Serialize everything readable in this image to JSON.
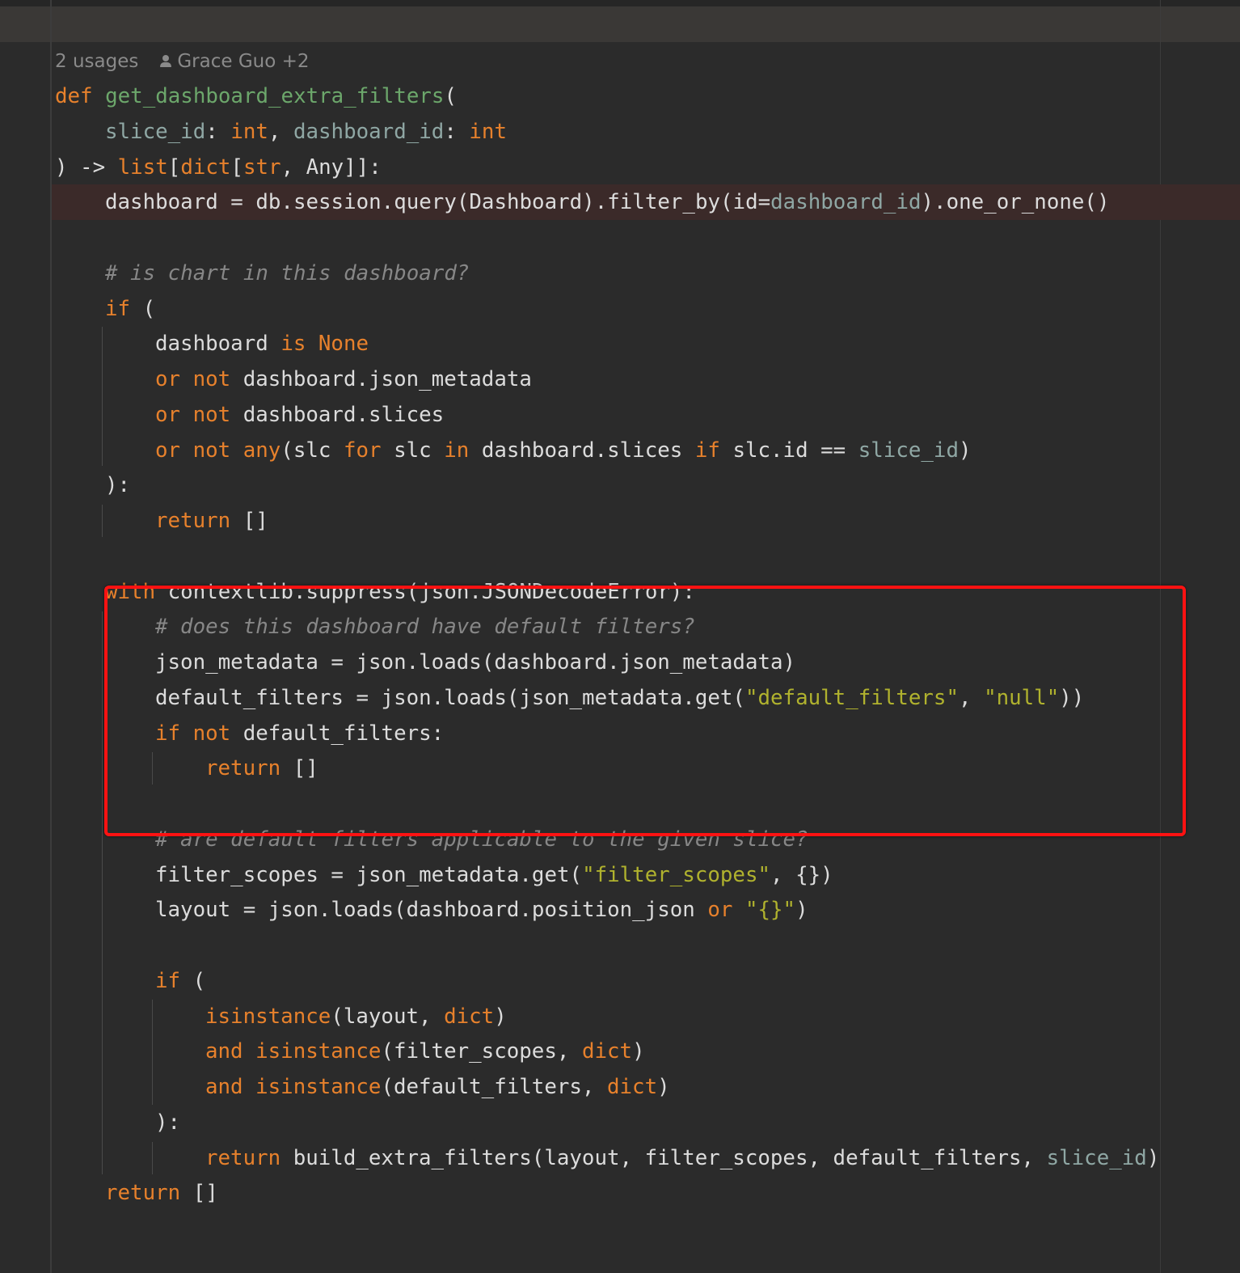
{
  "inlay": {
    "usages": "2 usages",
    "author": "Grace Guo +2"
  },
  "code": [
    {
      "indent": 0,
      "tokens": [
        [
          "k",
          "def "
        ],
        [
          "fn",
          "get_dashboard_extra_filters"
        ],
        [
          "t",
          "("
        ]
      ]
    },
    {
      "indent": 1,
      "tokens": [
        [
          "p",
          "slice_id"
        ],
        [
          "t",
          ": "
        ],
        [
          "k",
          "int"
        ],
        [
          "t",
          ", "
        ],
        [
          "p",
          "dashboard_id"
        ],
        [
          "t",
          ": "
        ],
        [
          "k",
          "int"
        ]
      ]
    },
    {
      "indent": 0,
      "tokens": [
        [
          "t",
          ") -> "
        ],
        [
          "k",
          "list"
        ],
        [
          "t",
          "["
        ],
        [
          "k",
          "dict"
        ],
        [
          "t",
          "["
        ],
        [
          "k",
          "str"
        ],
        [
          "t",
          ", Any]]:"
        ]
      ]
    },
    {
      "indent": 1,
      "error": true,
      "tokens": [
        [
          "t",
          "dashboard = db.session.query(Dashboard).filter_by(id="
        ],
        [
          "p",
          "dashboard_id"
        ],
        [
          "t",
          ").one_or_none()"
        ]
      ]
    },
    {
      "indent": 0,
      "tokens": []
    },
    {
      "indent": 1,
      "tokens": [
        [
          "c",
          "# is chart in this dashboard?"
        ]
      ]
    },
    {
      "indent": 1,
      "tokens": [
        [
          "k",
          "if "
        ],
        [
          "t",
          "("
        ]
      ]
    },
    {
      "indent": 2,
      "tokens": [
        [
          "t",
          "dashboard "
        ],
        [
          "k",
          "is None"
        ]
      ]
    },
    {
      "indent": 2,
      "tokens": [
        [
          "k",
          "or not "
        ],
        [
          "t",
          "dashboard.json_metadata"
        ]
      ]
    },
    {
      "indent": 2,
      "tokens": [
        [
          "k",
          "or not "
        ],
        [
          "t",
          "dashboard.slices"
        ]
      ]
    },
    {
      "indent": 2,
      "tokens": [
        [
          "k",
          "or not any"
        ],
        [
          "t",
          "(slc "
        ],
        [
          "k",
          "for "
        ],
        [
          "t",
          "slc "
        ],
        [
          "k",
          "in "
        ],
        [
          "t",
          "dashboard.slices "
        ],
        [
          "k",
          "if "
        ],
        [
          "t",
          "slc.id == "
        ],
        [
          "p",
          "slice_id"
        ],
        [
          "t",
          ")"
        ]
      ]
    },
    {
      "indent": 1,
      "tokens": [
        [
          "t",
          "):"
        ]
      ]
    },
    {
      "indent": 2,
      "tokens": [
        [
          "k",
          "return "
        ],
        [
          "t",
          "[]"
        ]
      ]
    },
    {
      "indent": 0,
      "tokens": []
    },
    {
      "indent": 1,
      "tokens": [
        [
          "k",
          "with "
        ],
        [
          "t",
          "contextlib.suppress(json.JSONDecodeError):"
        ]
      ]
    },
    {
      "indent": 2,
      "tokens": [
        [
          "c",
          "# does this dashboard have default filters?"
        ]
      ]
    },
    {
      "indent": 2,
      "tokens": [
        [
          "t",
          "json_metadata = json.loads(dashboard.json_metadata)"
        ]
      ]
    },
    {
      "indent": 2,
      "tokens": [
        [
          "t",
          "default_filters = json.loads(json_metadata.get("
        ],
        [
          "s",
          "\"default_filters\""
        ],
        [
          "t",
          ", "
        ],
        [
          "s",
          "\"null\""
        ],
        [
          "t",
          "))"
        ]
      ]
    },
    {
      "indent": 2,
      "tokens": [
        [
          "k",
          "if not "
        ],
        [
          "t",
          "default_filters:"
        ]
      ]
    },
    {
      "indent": 3,
      "tokens": [
        [
          "k",
          "return "
        ],
        [
          "t",
          "[]"
        ]
      ]
    },
    {
      "indent": 0,
      "tokens": []
    },
    {
      "indent": 2,
      "tokens": [
        [
          "c",
          "# are default filters applicable to the given slice?"
        ]
      ]
    },
    {
      "indent": 2,
      "tokens": [
        [
          "t",
          "filter_scopes = json_metadata.get("
        ],
        [
          "s",
          "\"filter_scopes\""
        ],
        [
          "t",
          ", {})"
        ]
      ]
    },
    {
      "indent": 2,
      "tokens": [
        [
          "t",
          "layout = json.loads(dashboard.position_json "
        ],
        [
          "k",
          "or "
        ],
        [
          "s",
          "\"{}\""
        ],
        [
          "t",
          ")"
        ]
      ]
    },
    {
      "indent": 0,
      "tokens": []
    },
    {
      "indent": 2,
      "tokens": [
        [
          "k",
          "if "
        ],
        [
          "t",
          "("
        ]
      ]
    },
    {
      "indent": 3,
      "tokens": [
        [
          "k",
          "isinstance"
        ],
        [
          "t",
          "(layout, "
        ],
        [
          "k",
          "dict"
        ],
        [
          "t",
          ")"
        ]
      ]
    },
    {
      "indent": 3,
      "tokens": [
        [
          "k",
          "and isinstance"
        ],
        [
          "t",
          "(filter_scopes, "
        ],
        [
          "k",
          "dict"
        ],
        [
          "t",
          ")"
        ]
      ]
    },
    {
      "indent": 3,
      "tokens": [
        [
          "k",
          "and isinstance"
        ],
        [
          "t",
          "(default_filters, "
        ],
        [
          "k",
          "dict"
        ],
        [
          "t",
          ")"
        ]
      ]
    },
    {
      "indent": 2,
      "tokens": [
        [
          "t",
          "):"
        ]
      ]
    },
    {
      "indent": 3,
      "tokens": [
        [
          "k",
          "return "
        ],
        [
          "t",
          "build_extra_filters(layout, filter_scopes, default_filters, "
        ],
        [
          "p",
          "slice_id"
        ],
        [
          "t",
          ")"
        ]
      ]
    },
    {
      "indent": 1,
      "tokens": [
        [
          "k",
          "return "
        ],
        [
          "t",
          "[]"
        ]
      ]
    }
  ],
  "colors": {
    "keyword": "#e7812c",
    "function": "#6ca76b",
    "param": "#8fa7a4",
    "string": "#b0b22e",
    "comment": "#878787",
    "text": "#dcdcdc",
    "highlight": "#ff1212"
  }
}
